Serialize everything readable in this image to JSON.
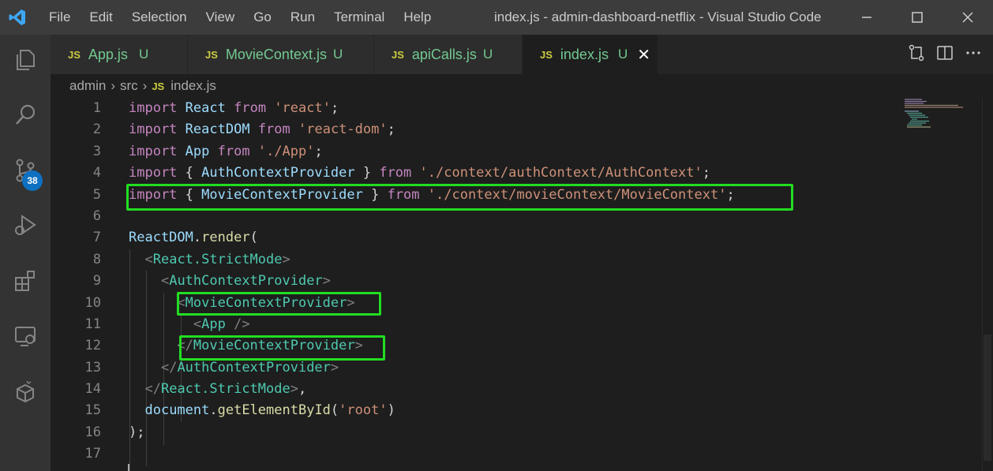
{
  "titlebar": {
    "menu": [
      "File",
      "Edit",
      "Selection",
      "View",
      "Go",
      "Run",
      "Terminal",
      "Help"
    ],
    "window_title": "index.js - admin-dashboard-netflix - Visual Studio Code"
  },
  "activitybar": {
    "icons": [
      "explorer-icon",
      "search-icon",
      "source-control-icon",
      "run-debug-icon",
      "extensions-icon",
      "remote-explorer-icon",
      "docker-icon"
    ],
    "scm_badge": "38"
  },
  "tabs": [
    {
      "lang": "JS",
      "label": "App.js",
      "status": "U"
    },
    {
      "lang": "JS",
      "label": "MovieContext.js",
      "status": "U"
    },
    {
      "lang": "JS",
      "label": "apiCalls.js",
      "status": "U"
    },
    {
      "lang": "JS",
      "label": "index.js",
      "status": "U",
      "close": "✕"
    }
  ],
  "breadcrumb": {
    "parts": [
      "admin",
      "src"
    ],
    "lang": "JS",
    "file": "index.js",
    "sep": "›"
  },
  "editor": {
    "line_numbers": [
      "1",
      "2",
      "3",
      "4",
      "5",
      "6",
      "7",
      "8",
      "9",
      "10",
      "11",
      "12",
      "13",
      "14",
      "15",
      "16",
      "17"
    ],
    "lines": [
      [
        [
          "kw",
          "import"
        ],
        [
          "plain",
          " "
        ],
        [
          "var",
          "React"
        ],
        [
          "plain",
          " "
        ],
        [
          "kw",
          "from"
        ],
        [
          "plain",
          " "
        ],
        [
          "str",
          "'react'"
        ],
        [
          "plain",
          ";"
        ]
      ],
      [
        [
          "kw",
          "import"
        ],
        [
          "plain",
          " "
        ],
        [
          "var",
          "ReactDOM"
        ],
        [
          "plain",
          " "
        ],
        [
          "kw",
          "from"
        ],
        [
          "plain",
          " "
        ],
        [
          "str",
          "'react-dom'"
        ],
        [
          "plain",
          ";"
        ]
      ],
      [
        [
          "kw",
          "import"
        ],
        [
          "plain",
          " "
        ],
        [
          "var",
          "App"
        ],
        [
          "plain",
          " "
        ],
        [
          "kw",
          "from"
        ],
        [
          "plain",
          " "
        ],
        [
          "str",
          "'./App'"
        ],
        [
          "plain",
          ";"
        ]
      ],
      [
        [
          "kw",
          "import"
        ],
        [
          "plain",
          " { "
        ],
        [
          "var",
          "AuthContextProvider"
        ],
        [
          "plain",
          " } "
        ],
        [
          "kw",
          "from"
        ],
        [
          "plain",
          " "
        ],
        [
          "str",
          "'./context/authContext/AuthContext'"
        ],
        [
          "plain",
          ";"
        ]
      ],
      [
        [
          "kw",
          "import"
        ],
        [
          "plain",
          " { "
        ],
        [
          "var",
          "MovieContextProvider"
        ],
        [
          "plain",
          " } "
        ],
        [
          "kw",
          "from"
        ],
        [
          "plain",
          " "
        ],
        [
          "str",
          "'./context/movieContext/MovieContext'"
        ],
        [
          "plain",
          ";"
        ]
      ],
      [],
      [
        [
          "var",
          "ReactDOM"
        ],
        [
          "plain",
          "."
        ],
        [
          "fn",
          "render"
        ],
        [
          "plain",
          "("
        ]
      ],
      [
        [
          "plain",
          "  "
        ],
        [
          "br",
          "<"
        ],
        [
          "tag",
          "React.StrictMode"
        ],
        [
          "br",
          ">"
        ]
      ],
      [
        [
          "plain",
          "    "
        ],
        [
          "br",
          "<"
        ],
        [
          "tag",
          "AuthContextProvider"
        ],
        [
          "br",
          ">"
        ]
      ],
      [
        [
          "plain",
          "      "
        ],
        [
          "br",
          "<"
        ],
        [
          "tag",
          "MovieContextProvider"
        ],
        [
          "br",
          ">"
        ]
      ],
      [
        [
          "plain",
          "        "
        ],
        [
          "br",
          "<"
        ],
        [
          "tag",
          "App"
        ],
        [
          "plain",
          " "
        ],
        [
          "br",
          "/>"
        ]
      ],
      [
        [
          "plain",
          "      "
        ],
        [
          "br",
          "</"
        ],
        [
          "tag",
          "MovieContextProvider"
        ],
        [
          "br",
          ">"
        ]
      ],
      [
        [
          "plain",
          "    "
        ],
        [
          "br",
          "</"
        ],
        [
          "tag",
          "AuthContextProvider"
        ],
        [
          "br",
          ">"
        ]
      ],
      [
        [
          "plain",
          "  "
        ],
        [
          "br",
          "</"
        ],
        [
          "tag",
          "React.StrictMode"
        ],
        [
          "br",
          ">"
        ],
        [
          "plain",
          ","
        ]
      ],
      [
        [
          "plain",
          "  "
        ],
        [
          "var",
          "document"
        ],
        [
          "plain",
          "."
        ],
        [
          "fn",
          "getElementById"
        ],
        [
          "plain",
          "("
        ],
        [
          "str",
          "'root'"
        ],
        [
          "plain",
          ")"
        ]
      ],
      [
        [
          "plain",
          ");"
        ]
      ],
      []
    ]
  }
}
